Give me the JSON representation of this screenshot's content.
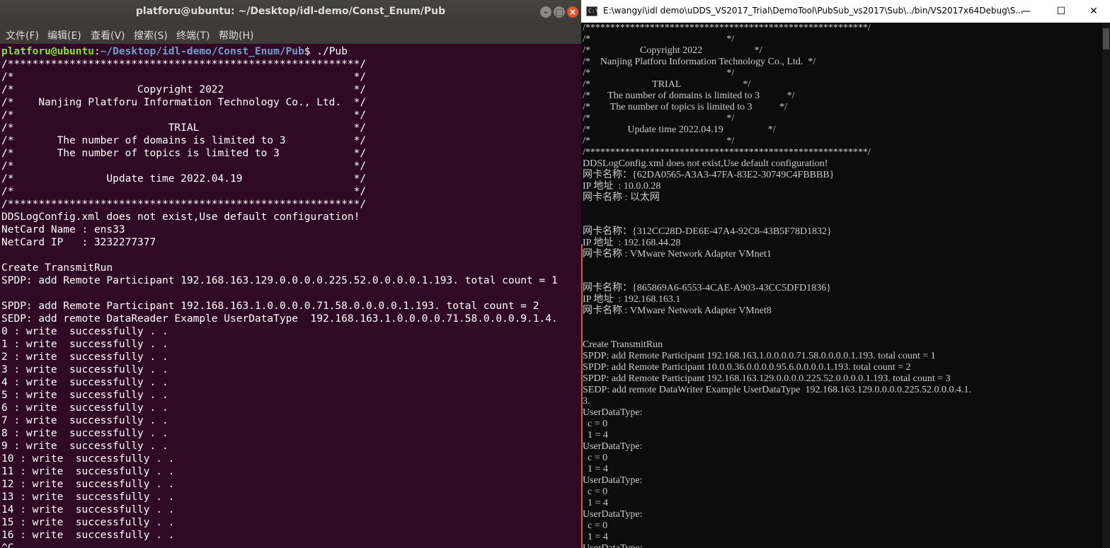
{
  "ubuntu": {
    "title": "platforu@ubuntu: ~/Desktop/idl-demo/Const_Enum/Pub",
    "window_buttons": {
      "minimize": "–",
      "maximize": "□",
      "close": "×"
    },
    "menu": [
      "文件(F)",
      "编辑(E)",
      "查看(V)",
      "搜索(S)",
      "终端(T)",
      "帮助(H)"
    ],
    "prompt": {
      "user": "platforu@ubuntu",
      "sep": ":",
      "path": "~/Desktop/idl-demo/Const_Enum/Pub",
      "tail": "$ ./Pub"
    },
    "lines": [
      "/*********************************************************/",
      "/*                                                       */",
      "/*                    Copyright 2022                     */",
      "/*    Nanjing Platforu Information Technology Co., Ltd.  */",
      "/*                                                       */",
      "/*                         TRIAL                         */",
      "/*       The number of domains is limited to 3           */",
      "/*       The number of topics is limited to 3            */",
      "/*                                                       */",
      "/*               Update time 2022.04.19                  */",
      "/*                                                       */",
      "/*********************************************************/",
      "DDSLogConfig.xml does not exist,Use default configuration!",
      "NetCard Name : ens33",
      "NetCard IP   : 3232277377",
      "",
      "Create TransmitRun",
      "SPDP: add Remote Participant 192.168.163.129.0.0.0.0.225.52.0.0.0.0.1.193. total count = 1",
      "",
      "SPDP: add Remote Participant 192.168.163.1.0.0.0.0.71.58.0.0.0.0.1.193. total count = 2",
      "SEDP: add remote DataReader Example UserDataType  192.168.163.1.0.0.0.0.71.58.0.0.0.9.1.4.",
      "0 : write  successfully . .",
      "1 : write  successfully . .",
      "2 : write  successfully . .",
      "3 : write  successfully . .",
      "4 : write  successfully . .",
      "5 : write  successfully . .",
      "6 : write  successfully . .",
      "7 : write  successfully . .",
      "8 : write  successfully . .",
      "9 : write  successfully . .",
      "10 : write  successfully . .",
      "11 : write  successfully . .",
      "12 : write  successfully . .",
      "13 : write  successfully . .",
      "14 : write  successfully . .",
      "15 : write  successfully . .",
      "16 : write  successfully . .",
      "^C"
    ]
  },
  "windows": {
    "title": "E:\\wangyi\\idl demo\\uDDS_VS2017_Trial\\DemoTool\\PubSub_vs2017\\Sub\\../bin/VS2017x64Debug\\S...",
    "icon_text": "C:\\",
    "window_buttons": {
      "minimize": "—",
      "maximize": "☐",
      "close": "✕"
    },
    "lines": [
      "/*********************************************************/",
      "/*                                                       */",
      "/*                    Copyright 2022                     */",
      "/*    Nanjing Platforu Information Technology Co., Ltd.  */",
      "/*                                                       */",
      "/*                         TRIAL                         */",
      "/*       The number of domains is limited to 3           */",
      "/*        The number of topics is limited to 3           */",
      "/*                                                       */",
      "/*               Update time 2022.04.19                  */",
      "/*                                                       */",
      "/*********************************************************/",
      "DDSLogConfig.xml does not exist,Use default configuration!",
      "网卡名称：{62DA0565-A3A3-47FA-83E2-30749C4FBBBB}",
      "IP 地址  : 10.0.0.28",
      "网卡名称 : 以太网",
      "",
      "",
      "网卡名称：{312CC28D-DE6E-47A4-92C8-43B5F78D1832}",
      "IP 地址  : 192.168.44.28",
      "网卡名称 : VMware Network Adapter VMnet1",
      "",
      "",
      "网卡名称：{865869A6-6553-4CAE-A903-43CC5DFD1836}",
      "IP 地址  : 192.168.163.1",
      "网卡名称 : VMware Network Adapter VMnet8",
      "",
      "",
      "Create TransmitRun",
      "SPDP: add Remote Participant 192.168.163.1.0.0.0.0.71.58.0.0.0.0.1.193. total count = 1",
      "SPDP: add Remote Participant 10.0.0.36.0.0.0.0.95.6.0.0.0.0.1.193. total count = 2",
      "SPDP: add Remote Participant 192.168.163.129.0.0.0.0.225.52.0.0.0.0.1.193. total count = 3",
      "SEDP: add remote DataWriter Example UserDataType  192.168.163.129.0.0.0.0.225.52.0.0.0.4.1.",
      "3.",
      "UserDataType:",
      "  c = 0",
      "  1 = 4",
      "UserDataType:",
      "  c = 0",
      "  1 = 4",
      "UserDataType:",
      "  c = 0",
      "  1 = 4",
      "UserDataType:",
      "  c = 0",
      "  1 = 4",
      "UserDataType:"
    ]
  }
}
